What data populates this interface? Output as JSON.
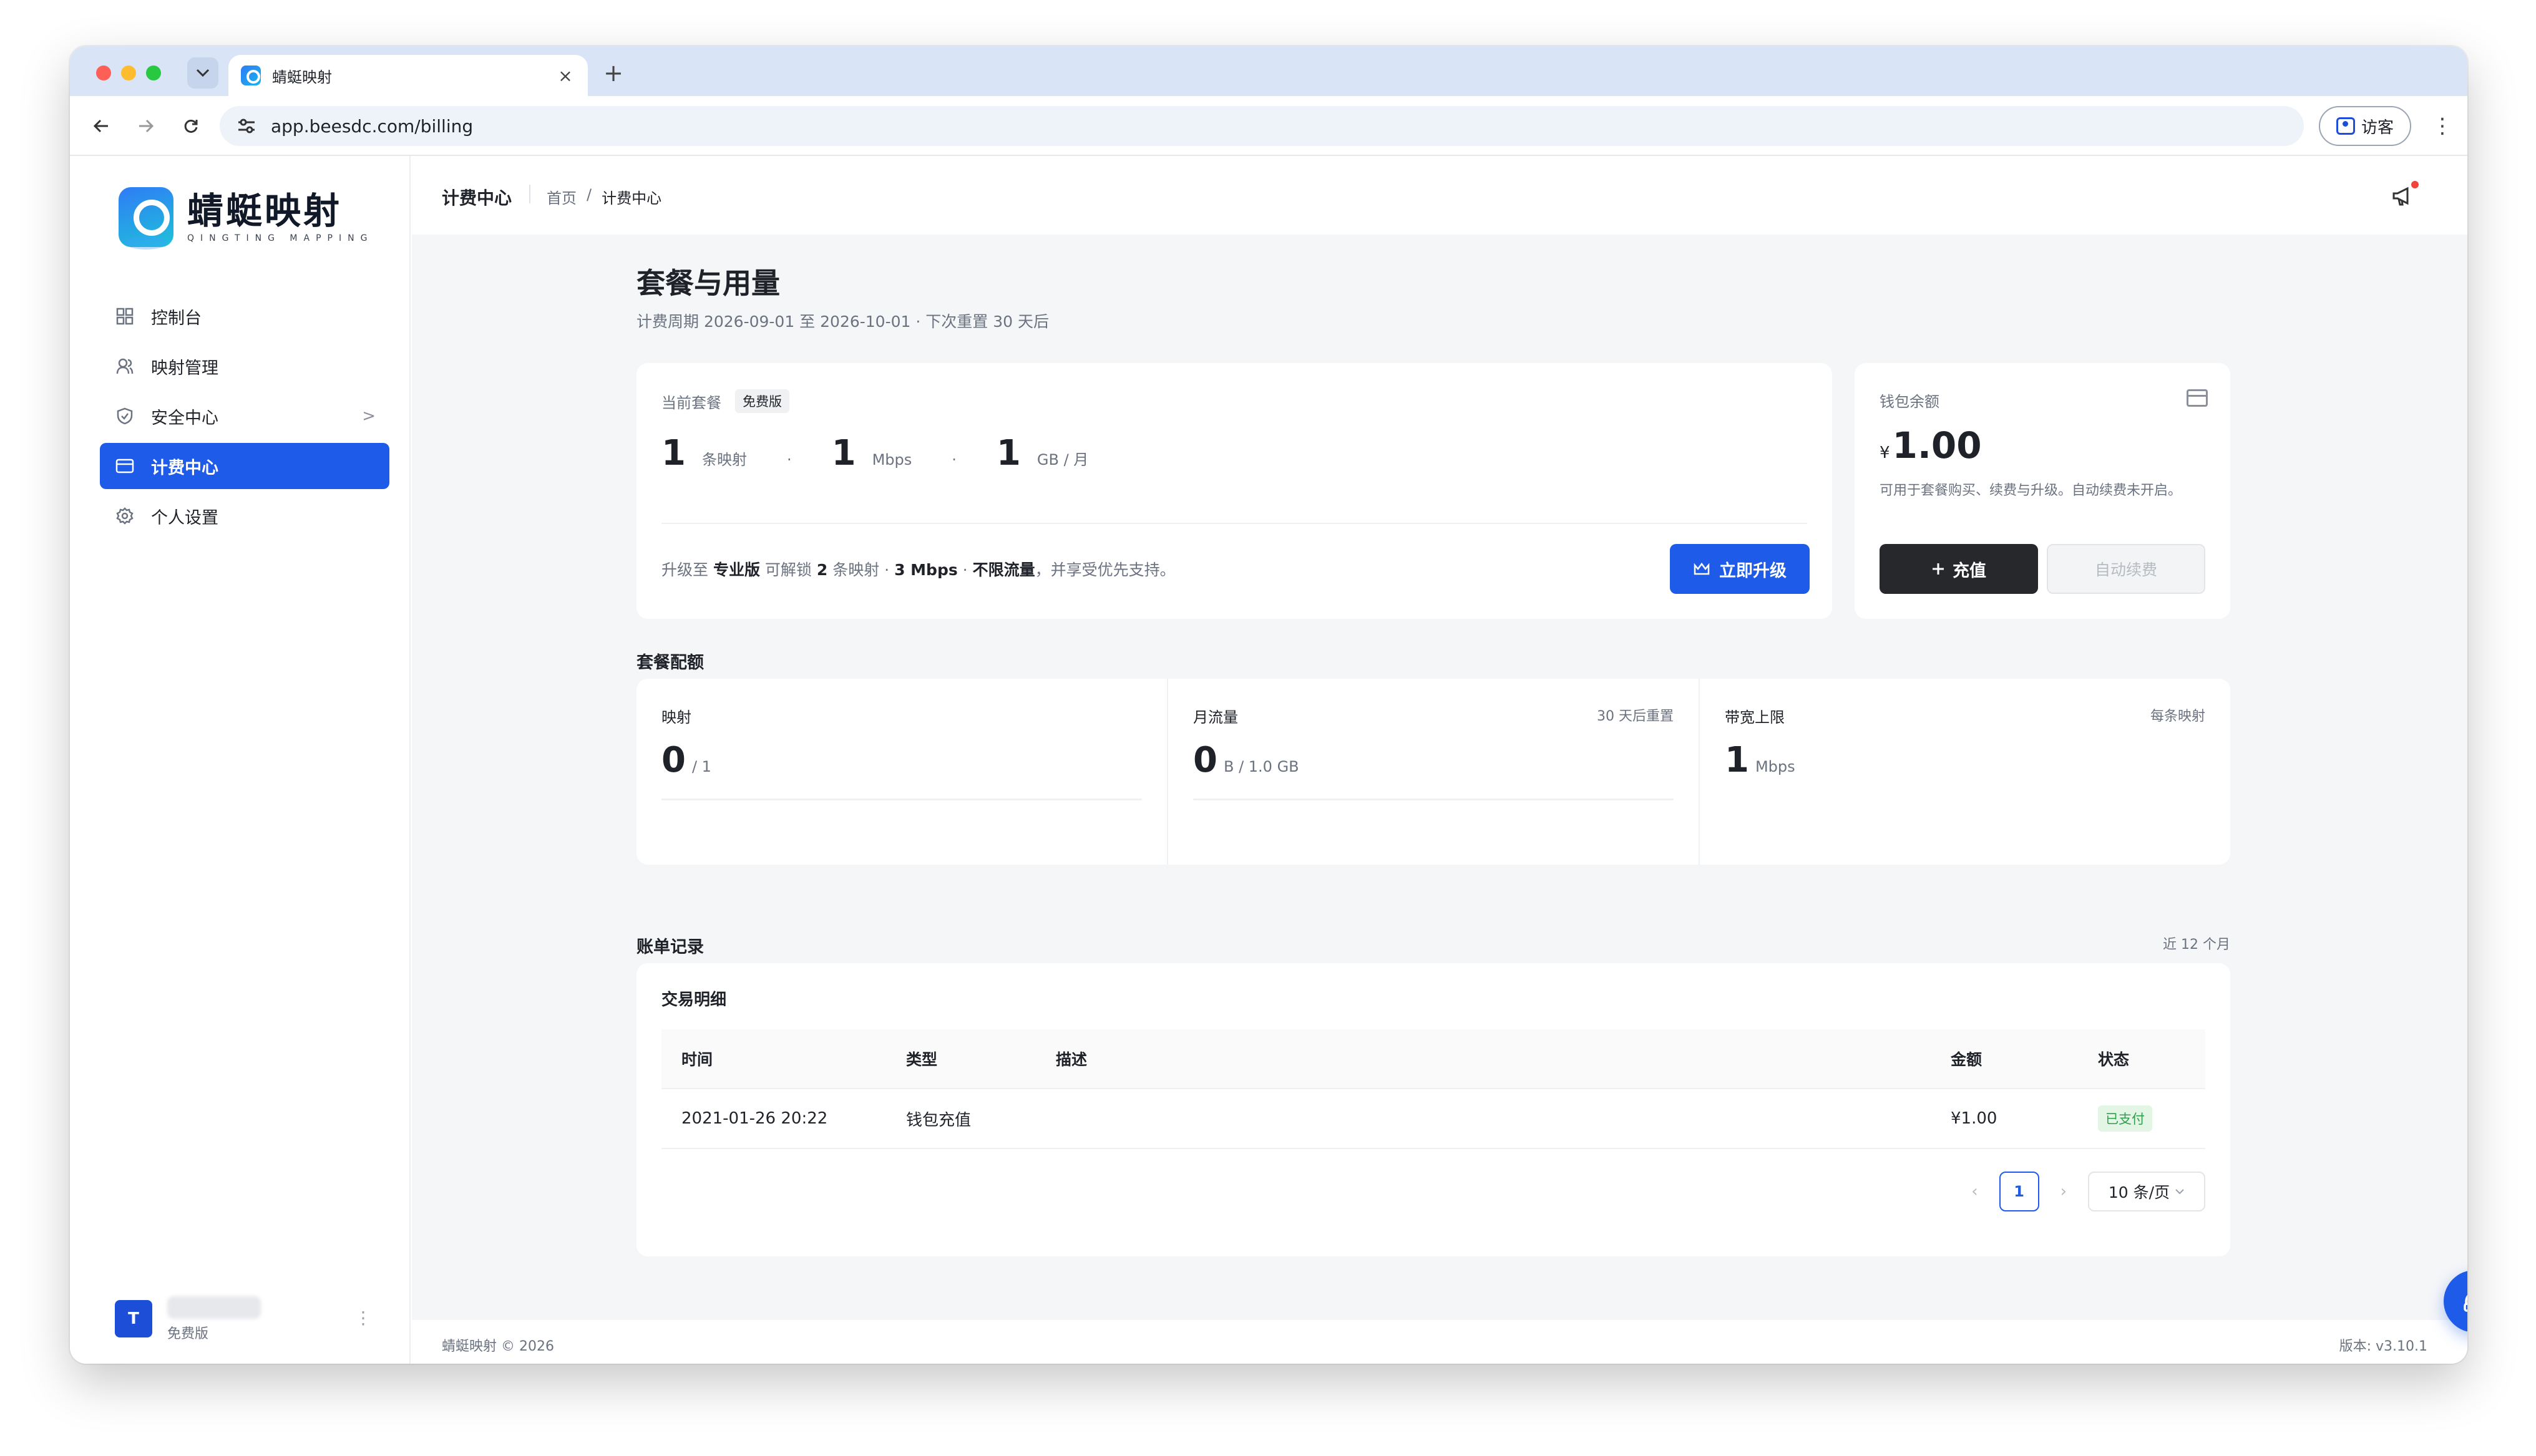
{
  "browser": {
    "tab_title": "蜻蜓映射",
    "tab_close": "×",
    "new_tab": "+",
    "url": "app.beesdc.com/billing",
    "guest_label": "访客",
    "more_menu": "⋮"
  },
  "sidebar": {
    "brand_cn": "蜻蜓映射",
    "brand_en": "QINGTING MAPPING",
    "items": [
      {
        "label": "控制台",
        "icon": "grid-icon"
      },
      {
        "label": "映射管理",
        "icon": "users-icon"
      },
      {
        "label": "安全中心",
        "icon": "shield-icon",
        "chevron": ">"
      },
      {
        "label": "计费中心",
        "icon": "card-icon",
        "active": true
      },
      {
        "label": "个人设置",
        "icon": "gear-icon"
      }
    ],
    "user": {
      "avatar_letter": "T",
      "plan": "免费版",
      "more": "⋮"
    }
  },
  "header": {
    "title": "计费中心",
    "breadcrumb": [
      "首页",
      "/",
      "计费中心"
    ]
  },
  "page": {
    "title": "套餐与用量",
    "subtitle": "计费周期 2026-09-01 至 2026-10-01 · 下次重置 30 天后"
  },
  "plan": {
    "label": "当前套餐",
    "badge": "免费版",
    "stats": [
      {
        "value": "1",
        "unit": "条映射"
      },
      {
        "value": "1",
        "unit": "Mbps"
      },
      {
        "value": "1",
        "unit": "GB / 月"
      }
    ],
    "separator": "·",
    "upsell": {
      "p1": "升级至 ",
      "tier": "专业版",
      "p2": " 可解锁 ",
      "maps_num": "2",
      "p3": " 条映射 · ",
      "bw": "3 Mbps",
      "p4": " · ",
      "traffic": "不限流量",
      "p5": "，并享受优先支持。"
    },
    "upgrade_label": "立即升级"
  },
  "wallet": {
    "label": "钱包余额",
    "currency": "¥",
    "amount": "1.00",
    "description": "可用于套餐购买、续费与升级。自动续费未开启。",
    "topup_label": "充值",
    "autorenew_label": "自动续费"
  },
  "quota": {
    "section_title": "套餐配额",
    "items": [
      {
        "label": "映射",
        "right": "",
        "value": "0",
        "unit": "/ 1",
        "fill": 0
      },
      {
        "label": "月流量",
        "right": "30 天后重置",
        "value": "0",
        "unit": "B / 1.0 GB",
        "fill": 0
      },
      {
        "label": "带宽上限",
        "right": "每条映射",
        "value": "1",
        "unit": "Mbps"
      }
    ]
  },
  "billing": {
    "section_title": "账单记录",
    "range": "近 12 个月",
    "card_title": "交易明细",
    "columns": [
      "时间",
      "类型",
      "描述",
      "金额",
      "状态"
    ],
    "rows": [
      {
        "time": "2021-01-26 20:22",
        "type": "钱包充值",
        "desc": "",
        "amount": "¥1.00",
        "status": "已支付"
      }
    ],
    "pager": {
      "prev": "‹",
      "current": "1",
      "next": "›",
      "page_size": "10 条/页"
    }
  },
  "footer": {
    "copyright": "蜻蜓映射 © 2026",
    "version": "版本: v3.10.1"
  },
  "colors": {
    "accent": "#1d5be8",
    "dark_button": "#26282c",
    "success": "#2f9e4a"
  }
}
